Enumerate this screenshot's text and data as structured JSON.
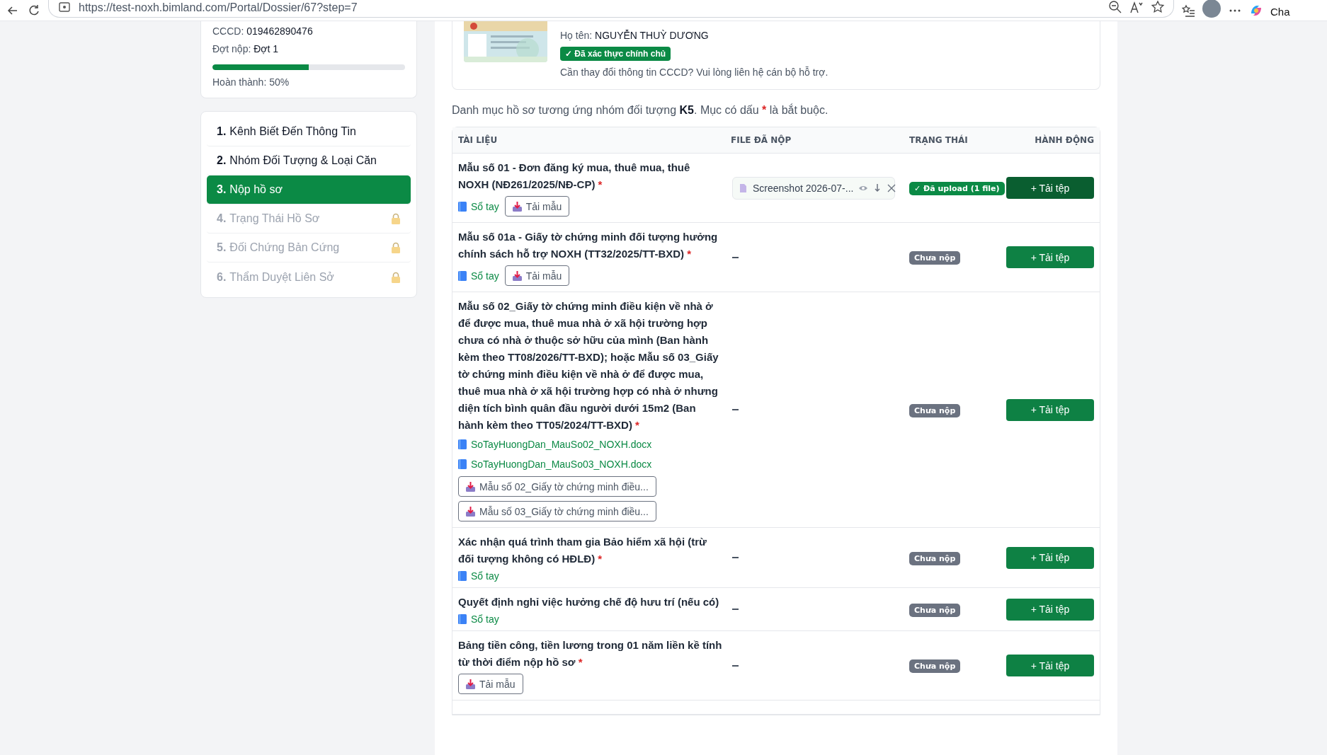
{
  "browser": {
    "url": "https://test-noxh.bimland.com/Portal/Dossier/67?step=7",
    "profile_label": "Cha"
  },
  "summary": {
    "fields": [
      {
        "label": "CCCD:",
        "value": "019462890476"
      },
      {
        "label": "Đợt nộp:",
        "value": "Đợt 1"
      }
    ],
    "progress": {
      "level": 0.5,
      "label": "Hoàn thành: 50%"
    }
  },
  "steps": [
    {
      "number": "1.",
      "label": "Kênh Biết Đến Thông Tin",
      "selected": false,
      "locked": false
    },
    {
      "number": "2.",
      "label": "Nhóm Đối Tượng & Loại Căn",
      "selected": false,
      "locked": false
    },
    {
      "number": "3.",
      "label": "Nộp hồ sơ",
      "selected": true,
      "locked": false
    },
    {
      "number": "4.",
      "label": "Trạng Thái Hồ Sơ",
      "selected": false,
      "locked": true
    },
    {
      "number": "5.",
      "label": "Đối Chứng Bản Cứng",
      "selected": false,
      "locked": true
    },
    {
      "number": "6.",
      "label": "Thẩm Duyệt Liên Sở",
      "selected": false,
      "locked": true
    }
  ],
  "id_card": {
    "name_label": "Họ tên:",
    "name_value": "NGUYỄN THUỲ DƯƠNG",
    "verified_badge": "✓ Đã xác thực chính chủ",
    "note": "Cần thay đổi thông tin CCCD? Vui lòng liên hệ cán bộ hỗ trợ."
  },
  "intro": {
    "text": "Danh mục hồ sơ tương ứng nhóm đối tượng **K5**. Mục có dấu",
    "mark": "*",
    "after": "là bắt buộc."
  },
  "table": {
    "columns": [
      "TÀI LIỆU",
      "FILE ĐÃ NỘP",
      "TRẠNG THÁI",
      "HÀNH ĐỘNG"
    ],
    "rows": [
      {
        "title": "Mẫu số 01 - Đơn đăng ký mua, thuê mua, thuê NOXH (NĐ261/2025/NĐ-CP)",
        "required": true,
        "resources": [
          {
            "kind": "handbook",
            "label": "Sổ tay"
          },
          {
            "kind": "template",
            "label": "Tải mẫu"
          }
        ],
        "file": {
          "kind": "chip",
          "name": "Screenshot 2026-07-..."
        },
        "status": {
          "kind": "uploaded",
          "label": "✓ Đã upload (1 file)"
        },
        "button": {
          "label": "+ Tải tệp",
          "hovered": true
        }
      },
      {
        "title": "Mẫu số 01a - Giấy tờ chứng minh đối tượng hưởng chính sách hỗ trợ NOXH (TT32/2025/TT-BXD)",
        "required": true,
        "resources": [
          {
            "kind": "handbook",
            "label": "Sổ tay"
          },
          {
            "kind": "template",
            "label": "Tải mẫu"
          }
        ],
        "file": {
          "kind": "empty"
        },
        "status": {
          "kind": "pending",
          "label": "Chưa nộp"
        },
        "button": {
          "label": "+ Tải tệp",
          "hovered": false
        }
      },
      {
        "title": "Mẫu số 02_Giấy tờ chứng minh điều kiện về nhà ở để được mua, thuê mua nhà ở xã hội trường hợp chưa có nhà ở thuộc sở hữu của mình (Ban hành kèm theo TT08/2026/TT-BXD); hoặc Mẫu số 03_Giấy tờ chứng minh điều kiện về nhà ở để được mua, thuê mua nhà ở xã hội trường hợp có nhà ở nhưng diện tích bình quân đầu người dưới 15m2 (Ban hành kèm theo TT05/2024/TT-BXD)",
        "required": true,
        "resources": [
          {
            "kind": "file_link",
            "label": "SoTayHuongDan_MauSo02_NOXH.docx"
          },
          {
            "kind": "file_link",
            "label": "SoTayHuongDan_MauSo03_NOXH.docx"
          },
          {
            "kind": "template",
            "label": "Mẫu số 02_Giấy tờ chứng minh điều..."
          },
          {
            "kind": "template",
            "label": "Mẫu số 03_Giấy tờ chứng minh điều..."
          }
        ],
        "file": {
          "kind": "empty"
        },
        "status": {
          "kind": "pending",
          "label": "Chưa nộp"
        },
        "button": {
          "label": "+ Tải tệp",
          "hovered": false
        }
      },
      {
        "title": "Xác nhận quá trình tham gia Bảo hiểm xã hội (trừ đối tượng không có HĐLĐ)",
        "required": true,
        "resources": [
          {
            "kind": "handbook",
            "label": "Sổ tay"
          }
        ],
        "file": {
          "kind": "empty"
        },
        "status": {
          "kind": "pending",
          "label": "Chưa nộp"
        },
        "button": {
          "label": "+ Tải tệp",
          "hovered": false
        }
      },
      {
        "title": "Quyết định nghỉ việc hưởng chế độ hưu trí (nếu có)",
        "required": false,
        "resources": [
          {
            "kind": "handbook",
            "label": "Sổ tay"
          }
        ],
        "file": {
          "kind": "empty"
        },
        "status": {
          "kind": "pending",
          "label": "Chưa nộp"
        },
        "button": {
          "label": "+ Tải tệp",
          "hovered": false
        }
      },
      {
        "title": "Bảng tiền công, tiền lương trong 01 năm liền kề tính từ thời điểm nộp hồ sơ",
        "required": true,
        "resources": [
          {
            "kind": "template",
            "label": "Tải mẫu"
          }
        ],
        "file": {
          "kind": "empty"
        },
        "status": {
          "kind": "pending",
          "label": "Chưa nộp"
        },
        "button": {
          "label": "+ Tải tệp",
          "hovered": false
        }
      }
    ]
  }
}
